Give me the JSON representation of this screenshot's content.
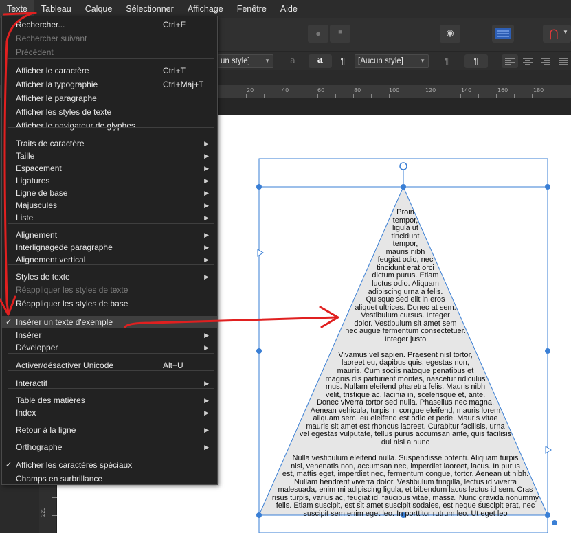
{
  "menubar": {
    "items": [
      "Texte",
      "Tableau",
      "Calque",
      "Sélectionner",
      "Affichage",
      "Fenêtre",
      "Aide"
    ]
  },
  "toolbar": {
    "para_style": "[Aucun style]",
    "char_style_partial": "un style]",
    "glyph_a1": "a",
    "glyph_a2": "a",
    "pilcrow1": "¶",
    "pilcrow2": "¶",
    "pilcrow3": "¶"
  },
  "ruler": {
    "h_ticks": [
      "20",
      "40",
      "60",
      "80",
      "100",
      "120",
      "140",
      "160",
      "180"
    ],
    "v_label": "220"
  },
  "menu": {
    "items": [
      {
        "label": "Rechercher...",
        "shortcut": "Ctrl+F"
      },
      {
        "label": "Rechercher suivant",
        "disabled": true
      },
      {
        "label": "Précédent",
        "disabled": true
      },
      {
        "label": "Afficher le caractère",
        "shortcut": "Ctrl+T"
      },
      {
        "label": "Afficher la typographie",
        "shortcut": "Ctrl+Maj+T"
      },
      {
        "label": "Afficher le paragraphe"
      },
      {
        "label": "Afficher les styles de texte"
      },
      {
        "label": "Afficher le navigateur de glyphes"
      },
      {
        "label": "Traits de caractère",
        "submenu": true
      },
      {
        "label": "Taille",
        "submenu": true
      },
      {
        "label": "Espacement",
        "submenu": true
      },
      {
        "label": "Ligatures",
        "submenu": true
      },
      {
        "label": "Ligne de base",
        "submenu": true
      },
      {
        "label": "Majuscules",
        "submenu": true
      },
      {
        "label": "Liste",
        "submenu": true
      },
      {
        "label": "Alignement",
        "submenu": true
      },
      {
        "label": "Interlignagede paragraphe",
        "submenu": true
      },
      {
        "label": "Alignement vertical",
        "submenu": true
      },
      {
        "label": "Styles de texte",
        "submenu": true
      },
      {
        "label": "Réappliquer les styles de texte",
        "disabled": true
      },
      {
        "label": "Réappliquer les styles de base"
      },
      {
        "label": "Insérer un texte d'exemple",
        "checked": true,
        "highlighted": true
      },
      {
        "label": "Insérer",
        "submenu": true
      },
      {
        "label": "Développer",
        "submenu": true
      },
      {
        "label": "Activer/désactiver Unicode",
        "shortcut": "Alt+U"
      },
      {
        "label": "Interactif",
        "submenu": true
      },
      {
        "label": "Table des matières",
        "submenu": true
      },
      {
        "label": "Index",
        "submenu": true
      },
      {
        "label": "Retour à la ligne",
        "submenu": true
      },
      {
        "label": "Orthographe",
        "submenu": true
      },
      {
        "label": "Afficher les caractères spéciaux",
        "checked": true
      },
      {
        "label": "Champs en surbrillance"
      }
    ]
  },
  "document": {
    "text_lines": [
      "Proin",
      "tempor,",
      "ligula ut",
      "tincidunt",
      "tempor,",
      "mauris nibh",
      "feugiat odio, nec",
      "tincidunt erat orci",
      "dictum purus. Etiam",
      "luctus odio. Aliquam",
      "adipiscing urna a felis.",
      "Quisque sed elit in eros",
      "aliquet ultrices. Donec at sem.",
      "Vestibulum cursus. Integer",
      "dolor. Vestibulum sit amet sem",
      "nec augue fermentum consectetuer.",
      "Integer justo",
      "",
      "Vivamus vel sapien. Praesent nisl tortor,",
      "laoreet eu, dapibus quis, egestas non,",
      "mauris. Cum sociis natoque penatibus et",
      "magnis dis parturient montes, nascetur ridiculus",
      "mus. Nullam eleifend pharetra felis. Mauris nibh",
      "velit, tristique ac, lacinia in, scelerisque et, ante.",
      "Donec viverra tortor sed nulla. Phasellus nec magna.",
      "Aenean vehicula, turpis in congue eleifend, mauris lorem",
      "aliquam sem, eu eleifend est odio et pede. Mauris vitae",
      "mauris sit amet est rhoncus laoreet. Curabitur facilisis, urna",
      "vel egestas vulputate, tellus purus accumsan ante, quis facilisis",
      "dui nisl a nunc",
      "",
      "Nulla vestibulum eleifend nulla. Suspendisse potenti. Aliquam turpis",
      "nisi, venenatis non, accumsan nec, imperdiet laoreet, lacus. In purus",
      "est, mattis eget, imperdiet nec, fermentum congue, tortor. Aenean ut nibh.",
      "Nullam hendrerit viverra dolor. Vestibulum fringilla, lectus id viverra",
      "malesuada, enim mi adipiscing ligula, et bibendum lacus lectus id sem. Cras",
      "risus turpis, varius ac, feugiat id, faucibus vitae, massa. Nunc gravida nonummy",
      "felis. Etiam suscipit, est sit amet suscipit sodales, est neque suscipit erat, nec",
      "suscipit sem enim eget leo. In porttitor rutrum leo. Ut eget leo"
    ]
  },
  "colors": {
    "annotation": "#e02020",
    "selection": "#3a7fd5",
    "shape_fill": "#e6e6e6"
  }
}
